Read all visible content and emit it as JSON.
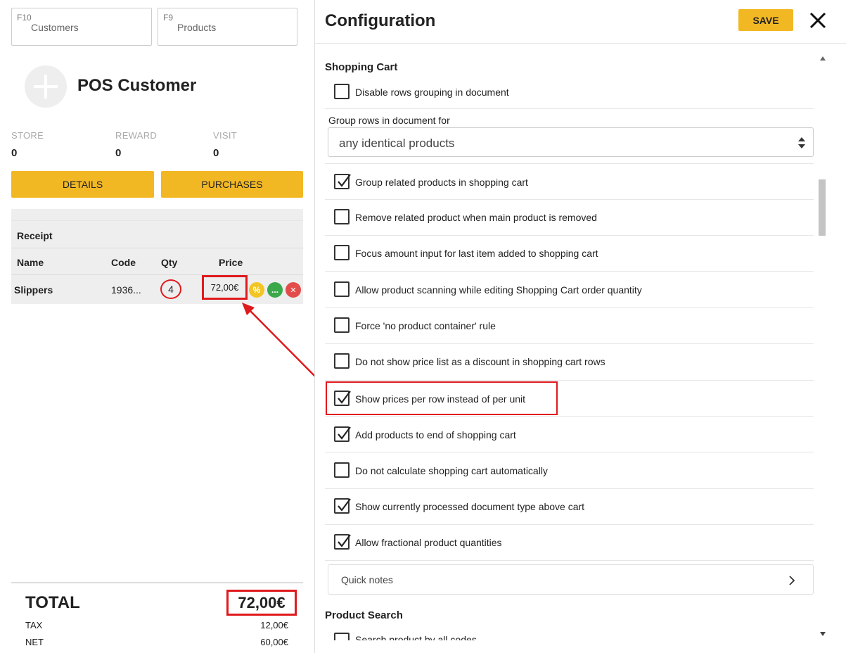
{
  "left": {
    "search_customers": {
      "key": "F10",
      "label": "Customers"
    },
    "search_products": {
      "key": "F9",
      "label": "Products"
    },
    "customer_name": "POS Customer",
    "stats": [
      {
        "label": "STORE",
        "value": "0"
      },
      {
        "label": "REWARD",
        "value": "0"
      },
      {
        "label": "VISIT",
        "value": "0"
      }
    ],
    "buttons": {
      "details": "DETAILS",
      "purchases": "PURCHASES"
    },
    "receipt": {
      "title": "Receipt",
      "headers": {
        "name": "Name",
        "code": "Code",
        "qty": "Qty",
        "price": "Price"
      },
      "rows": [
        {
          "name": "Slippers",
          "code": "1936...",
          "qty": "4",
          "price": "72,00€"
        }
      ],
      "row_actions": {
        "discount": "%",
        "more": "...",
        "remove": "✕"
      }
    },
    "totals": {
      "total_label": "TOTAL",
      "total_value": "72,00€",
      "tax_label": "TAX",
      "tax_value": "12,00€",
      "net_label": "NET",
      "net_value": "60,00€"
    }
  },
  "config": {
    "title": "Configuration",
    "save_label": "SAVE",
    "sections": [
      {
        "title": "Shopping Cart"
      },
      {
        "title": "Product Search"
      }
    ],
    "options": [
      {
        "label": "Disable rows grouping in document",
        "checked": false
      },
      {
        "label": "Group related products in shopping cart",
        "checked": true
      },
      {
        "label": "Remove related product when main product is removed",
        "checked": false
      },
      {
        "label": "Focus amount input for last item added to shopping cart",
        "checked": false
      },
      {
        "label": "Allow product scanning while editing Shopping Cart order quantity",
        "checked": false
      },
      {
        "label": "Force 'no product container' rule",
        "checked": false
      },
      {
        "label": "Do not show price list as a discount in shopping cart rows",
        "checked": false
      },
      {
        "label": "Show prices per row instead of per unit",
        "checked": true
      },
      {
        "label": "Add products to end of shopping cart",
        "checked": true
      },
      {
        "label": "Do not calculate shopping cart automatically",
        "checked": false
      },
      {
        "label": "Show currently processed document type above cart",
        "checked": true
      },
      {
        "label": "Allow fractional product quantities",
        "checked": true
      },
      {
        "label": "Search product by all codes",
        "checked": false
      }
    ],
    "group_rows": {
      "label": "Group rows in document for",
      "value": "any identical products"
    },
    "quick_notes": "Quick notes"
  },
  "colors": {
    "accent": "#f2b824",
    "highlight": "#e0191c",
    "green": "#3aa84b",
    "red": "#e24c4b"
  }
}
